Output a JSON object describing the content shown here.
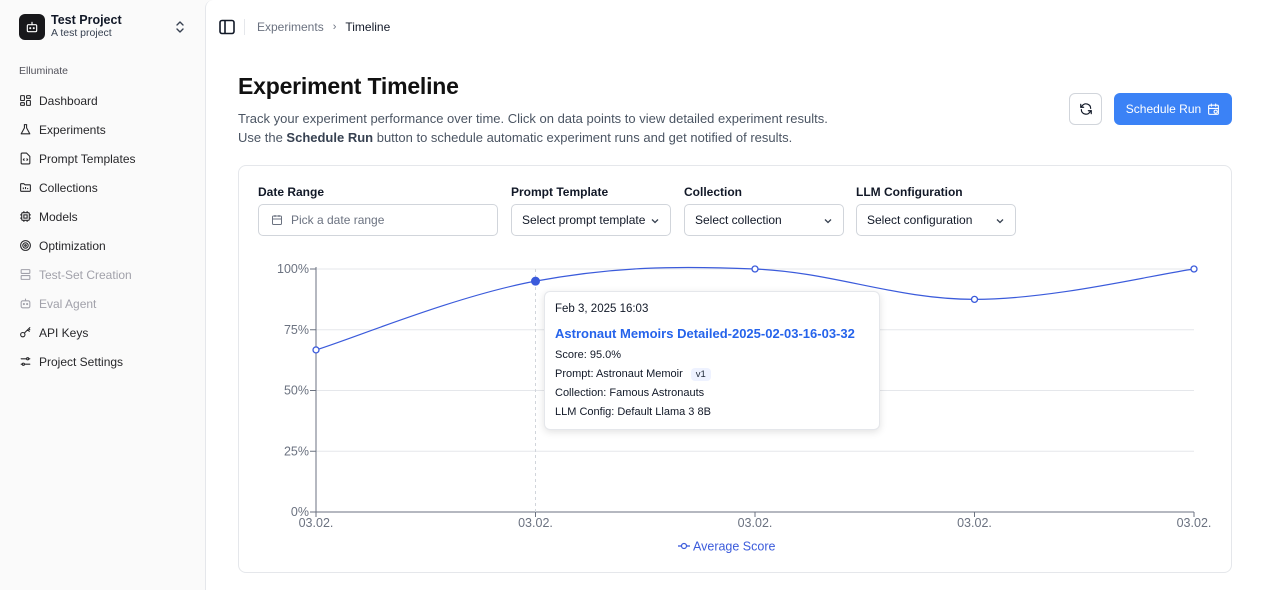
{
  "project": {
    "name": "Test Project",
    "subtitle": "A test project"
  },
  "sidebar": {
    "section_label": "Elluminate",
    "items": [
      {
        "label": "Dashboard",
        "icon": "dashboard-icon",
        "disabled": false
      },
      {
        "label": "Experiments",
        "icon": "flask-icon",
        "disabled": false
      },
      {
        "label": "Prompt Templates",
        "icon": "file-code-icon",
        "disabled": false
      },
      {
        "label": "Collections",
        "icon": "folder-icon",
        "disabled": false
      },
      {
        "label": "Models",
        "icon": "cpu-icon",
        "disabled": false
      },
      {
        "label": "Optimization",
        "icon": "target-icon",
        "disabled": false
      },
      {
        "label": "Test-Set Creation",
        "icon": "layers-icon",
        "disabled": true
      },
      {
        "label": "Eval Agent",
        "icon": "bot-icon",
        "disabled": true
      },
      {
        "label": "API Keys",
        "icon": "key-icon",
        "disabled": false
      },
      {
        "label": "Project Settings",
        "icon": "settings-icon",
        "disabled": false
      }
    ]
  },
  "breadcrumb": {
    "parent": "Experiments",
    "current": "Timeline"
  },
  "page": {
    "title": "Experiment Timeline",
    "desc_line1": "Track your experiment performance over time. Click on data points to view detailed experiment results.",
    "desc_line2_pre": "Use the ",
    "desc_line2_bold": "Schedule Run",
    "desc_line2_post": " button to schedule automatic experiment runs and get notified of results."
  },
  "actions": {
    "schedule_label": "Schedule Run",
    "accent_color": "#3b82f6"
  },
  "filters": {
    "date_range": {
      "label": "Date Range",
      "placeholder": "Pick a date range"
    },
    "prompt_template": {
      "label": "Prompt Template",
      "value": "Select prompt template"
    },
    "collection": {
      "label": "Collection",
      "value": "Select collection"
    },
    "llm_config": {
      "label": "LLM Configuration",
      "value": "Select configuration"
    }
  },
  "chart_data": {
    "type": "line",
    "x": [
      "03.02.",
      "03.02.",
      "03.02.",
      "03.02.",
      "03.02."
    ],
    "series": [
      {
        "name": "Average Score",
        "values": [
          66.7,
          95.0,
          100,
          87.5,
          100
        ],
        "color": "#3b5bdb"
      }
    ],
    "ylim": [
      0,
      100
    ],
    "yticks": [
      "0%",
      "25%",
      "50%",
      "75%",
      "100%"
    ],
    "grid": true,
    "legend": "bottom",
    "active_index": 1
  },
  "tooltip": {
    "date": "Feb 3, 2025 16:03",
    "experiment_name": "Astronaut Memoirs Detailed-2025-02-03-16-03-32",
    "score": "Score: 95.0%",
    "prompt": "Prompt: Astronaut Memoir",
    "prompt_version": "v1",
    "collection": "Collection: Famous Astronauts",
    "llm_config": "LLM Config: Default Llama 3 8B"
  }
}
